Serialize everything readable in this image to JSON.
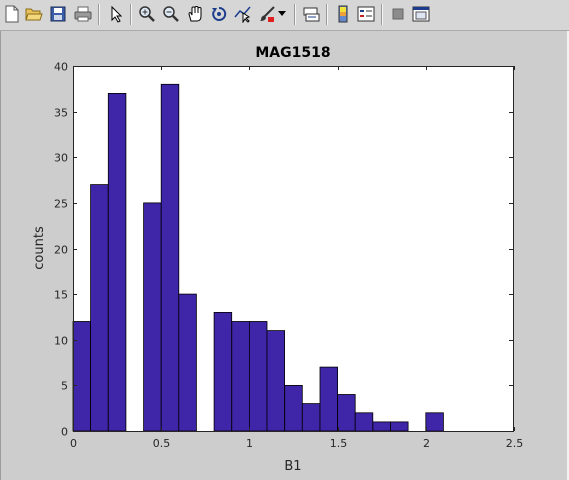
{
  "toolbar": {
    "buttons": [
      {
        "name": "new-figure-icon"
      },
      {
        "name": "open-file-icon"
      },
      {
        "name": "save-icon"
      },
      {
        "name": "print-icon"
      },
      {
        "name": "pointer-icon"
      },
      {
        "name": "zoom-in-icon"
      },
      {
        "name": "zoom-out-icon"
      },
      {
        "name": "pan-hand-icon"
      },
      {
        "name": "rotate-3d-icon"
      },
      {
        "name": "data-cursor-icon"
      },
      {
        "name": "brush-icon"
      },
      {
        "name": "link-plot-icon"
      },
      {
        "name": "colorbar-icon"
      },
      {
        "name": "legend-icon"
      },
      {
        "name": "hide-plot-tools-icon"
      },
      {
        "name": "show-plot-tools-icon"
      }
    ]
  },
  "chart_data": {
    "type": "bar",
    "title": "MAG1518",
    "xlabel": "B1",
    "ylabel": "counts",
    "xlim": [
      0,
      2.5
    ],
    "ylim": [
      0,
      40
    ],
    "xticks": [
      "0",
      "0.5",
      "1",
      "1.5",
      "2",
      "2.5"
    ],
    "yticks": [
      "0",
      "5",
      "10",
      "15",
      "20",
      "25",
      "30",
      "35",
      "40"
    ],
    "bin_width": 0.1,
    "bin_starts": [
      0,
      0.1,
      0.2,
      0.3,
      0.4,
      0.5,
      0.6,
      0.7,
      0.8,
      0.9,
      1.0,
      1.1,
      1.2,
      1.3,
      1.4,
      1.5,
      1.6,
      1.7,
      1.8,
      1.9,
      2.0
    ],
    "values": [
      12,
      27,
      37,
      0,
      25,
      38,
      15,
      0,
      13,
      12,
      12,
      11,
      5,
      3,
      7,
      4,
      2,
      1,
      1,
      0,
      2
    ],
    "grid": false,
    "bar_color": "#3f25a8",
    "edge_color": "#000000"
  }
}
